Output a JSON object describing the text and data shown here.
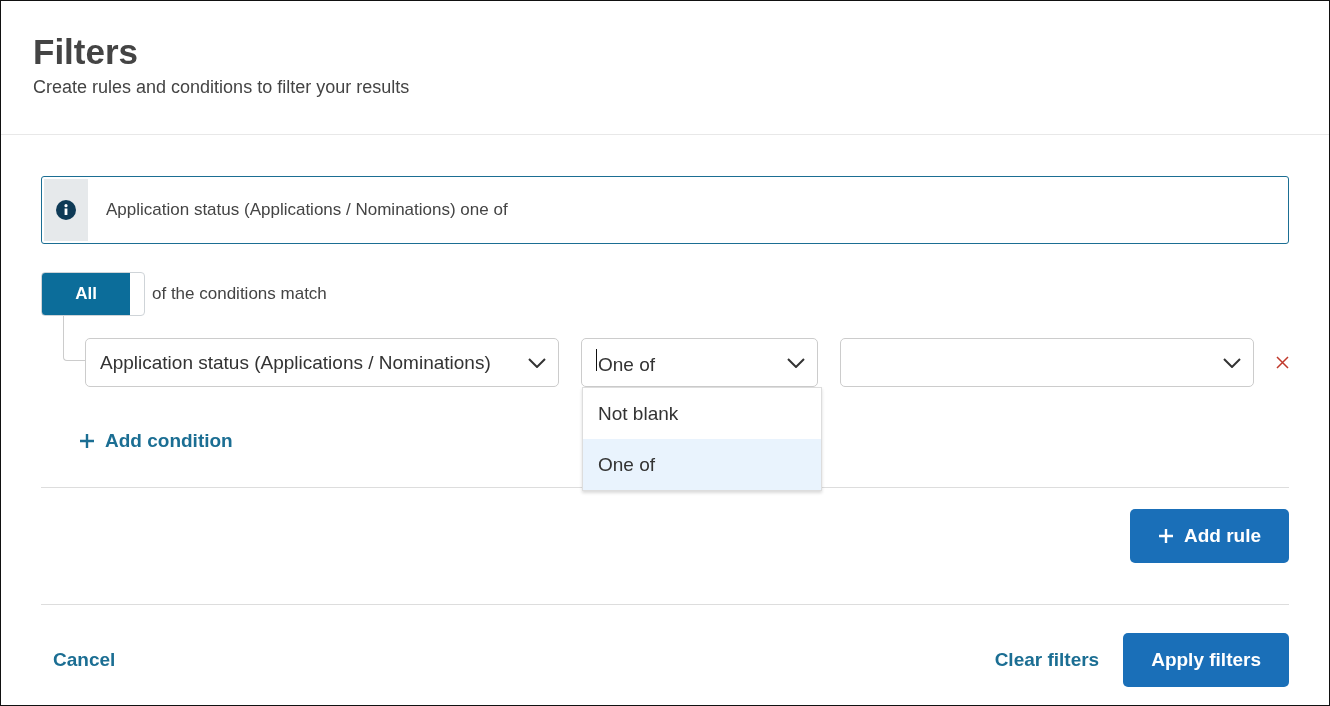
{
  "header": {
    "title": "Filters",
    "subtitle": "Create rules and conditions to filter your results"
  },
  "summary": "Application status (Applications / Nominations) one of",
  "match": {
    "mode": "All",
    "label": "of the conditions match"
  },
  "conditions": [
    {
      "field": "Application status (Applications / Nominations)",
      "operator": "One of",
      "operator_menu": {
        "expanded": true,
        "options": [
          {
            "label": "Not blank",
            "selected": false
          },
          {
            "label": "One of",
            "selected": true
          }
        ]
      }
    }
  ],
  "add_condition": "Add condition",
  "add_rule": "Add rule",
  "footer": {
    "cancel": "Cancel",
    "clear": "Clear filters",
    "apply": "Apply filters"
  }
}
